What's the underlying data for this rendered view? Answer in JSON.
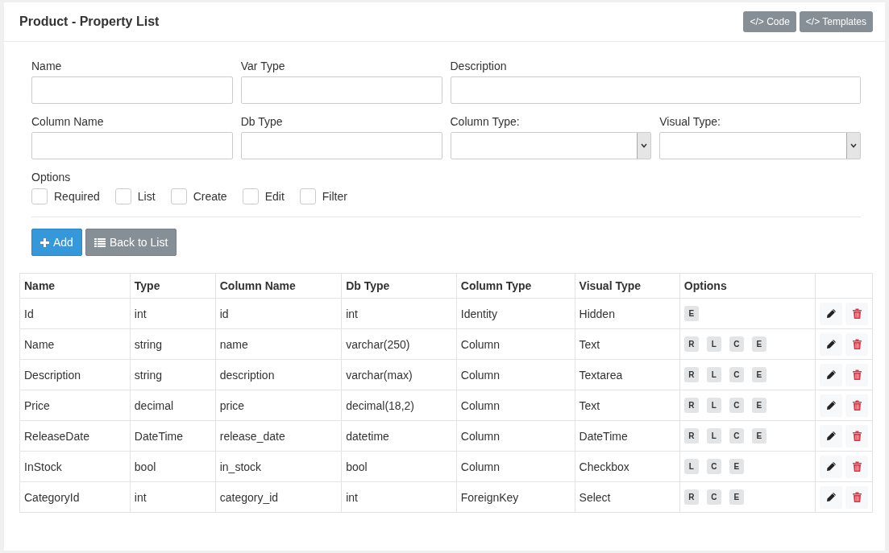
{
  "header": {
    "title": "Product - Property List",
    "buttons": [
      {
        "icon": "</>",
        "label": "Code"
      },
      {
        "icon": "</>",
        "label": "Templates"
      }
    ]
  },
  "form": {
    "rows": [
      [
        {
          "kind": "text",
          "label": "Name"
        },
        {
          "kind": "text",
          "label": "Var Type"
        },
        {
          "kind": "text",
          "label": "Description"
        }
      ],
      [
        {
          "kind": "text",
          "label": "Column Name"
        },
        {
          "kind": "text",
          "label": "Db Type"
        },
        {
          "kind": "select",
          "label": "Column Type:"
        },
        {
          "kind": "select",
          "label": "Visual Type:"
        }
      ]
    ],
    "options_label": "Options",
    "options": [
      {
        "label": "Required",
        "checked": false
      },
      {
        "label": "List",
        "checked": false
      },
      {
        "label": "Create",
        "checked": false
      },
      {
        "label": "Edit",
        "checked": false
      },
      {
        "label": "Filter",
        "checked": false
      }
    ],
    "buttons": [
      {
        "kind": "primary",
        "label": "Add"
      },
      {
        "kind": "secondary",
        "label": "Back to List"
      }
    ]
  },
  "table": {
    "columns": [
      "Name",
      "Type",
      "Column Name",
      "Db Type",
      "Column Type",
      "Visual Type",
      "Options"
    ],
    "rows": [
      {
        "cells": [
          "Id",
          "int",
          "id",
          "int",
          "Identity",
          "Hidden"
        ],
        "options": [
          "E"
        ]
      },
      {
        "cells": [
          "Name",
          "string",
          "name",
          "varchar(250)",
          "Column",
          "Text"
        ],
        "options": [
          "R",
          "L",
          "C",
          "E"
        ]
      },
      {
        "cells": [
          "Description",
          "string",
          "description",
          "varchar(max)",
          "Column",
          "Textarea"
        ],
        "options": [
          "R",
          "L",
          "C",
          "E"
        ]
      },
      {
        "cells": [
          "Price",
          "decimal",
          "price",
          "decimal(18,2)",
          "Column",
          "Text"
        ],
        "options": [
          "R",
          "L",
          "C",
          "E"
        ]
      },
      {
        "cells": [
          "ReleaseDate",
          "DateTime",
          "release_date",
          "datetime",
          "Column",
          "DateTime"
        ],
        "options": [
          "R",
          "L",
          "C",
          "E"
        ]
      },
      {
        "cells": [
          "InStock",
          "bool",
          "in_stock",
          "bool",
          "Column",
          "Checkbox"
        ],
        "options": [
          "L",
          "C",
          "E"
        ]
      },
      {
        "cells": [
          "CategoryId",
          "int",
          "category_id",
          "int",
          "ForeignKey",
          "Select"
        ],
        "options": [
          "R",
          "C",
          "E"
        ]
      }
    ]
  }
}
